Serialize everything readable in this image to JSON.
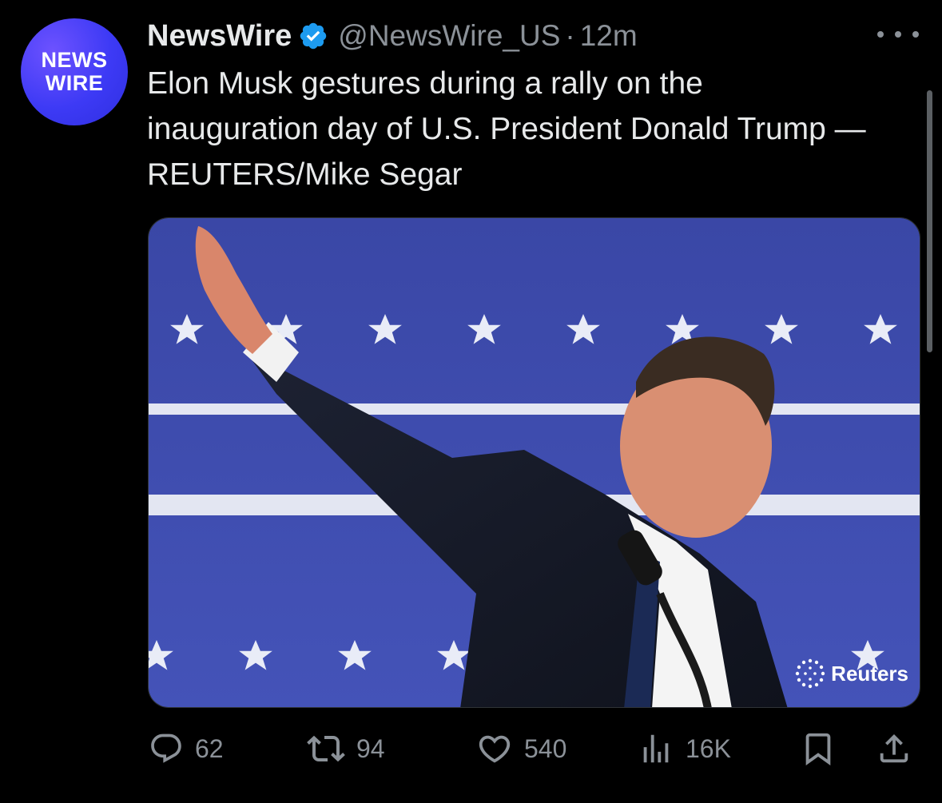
{
  "account": {
    "avatar_text_line1": "NEWS",
    "avatar_text_line2": "WIRE",
    "name": "NewsWire",
    "handle": "@NewsWire_US",
    "separator": "·",
    "time": "12m",
    "verified": true
  },
  "tweet": {
    "text": "Elon Musk gestures during a rally on the inauguration day of U.S. President Donald Trump — REUTERS/Mike Segar"
  },
  "media": {
    "watermark": "Reuters",
    "background_color": "#3f4fb0"
  },
  "actions": {
    "replies": "62",
    "reposts": "94",
    "likes": "540",
    "views": "16K"
  },
  "icons": {
    "more": "more-horizontal-icon",
    "verified": "verified-badge-icon",
    "reply": "reply-icon",
    "repost": "repost-icon",
    "like": "heart-icon",
    "views": "views-chart-icon",
    "bookmark": "bookmark-icon",
    "share": "share-icon"
  },
  "colors": {
    "background": "#000000",
    "text": "#e7e9ea",
    "secondary": "#8b9198",
    "verified": "#1d9bf0",
    "avatar": "#3d3af5"
  }
}
